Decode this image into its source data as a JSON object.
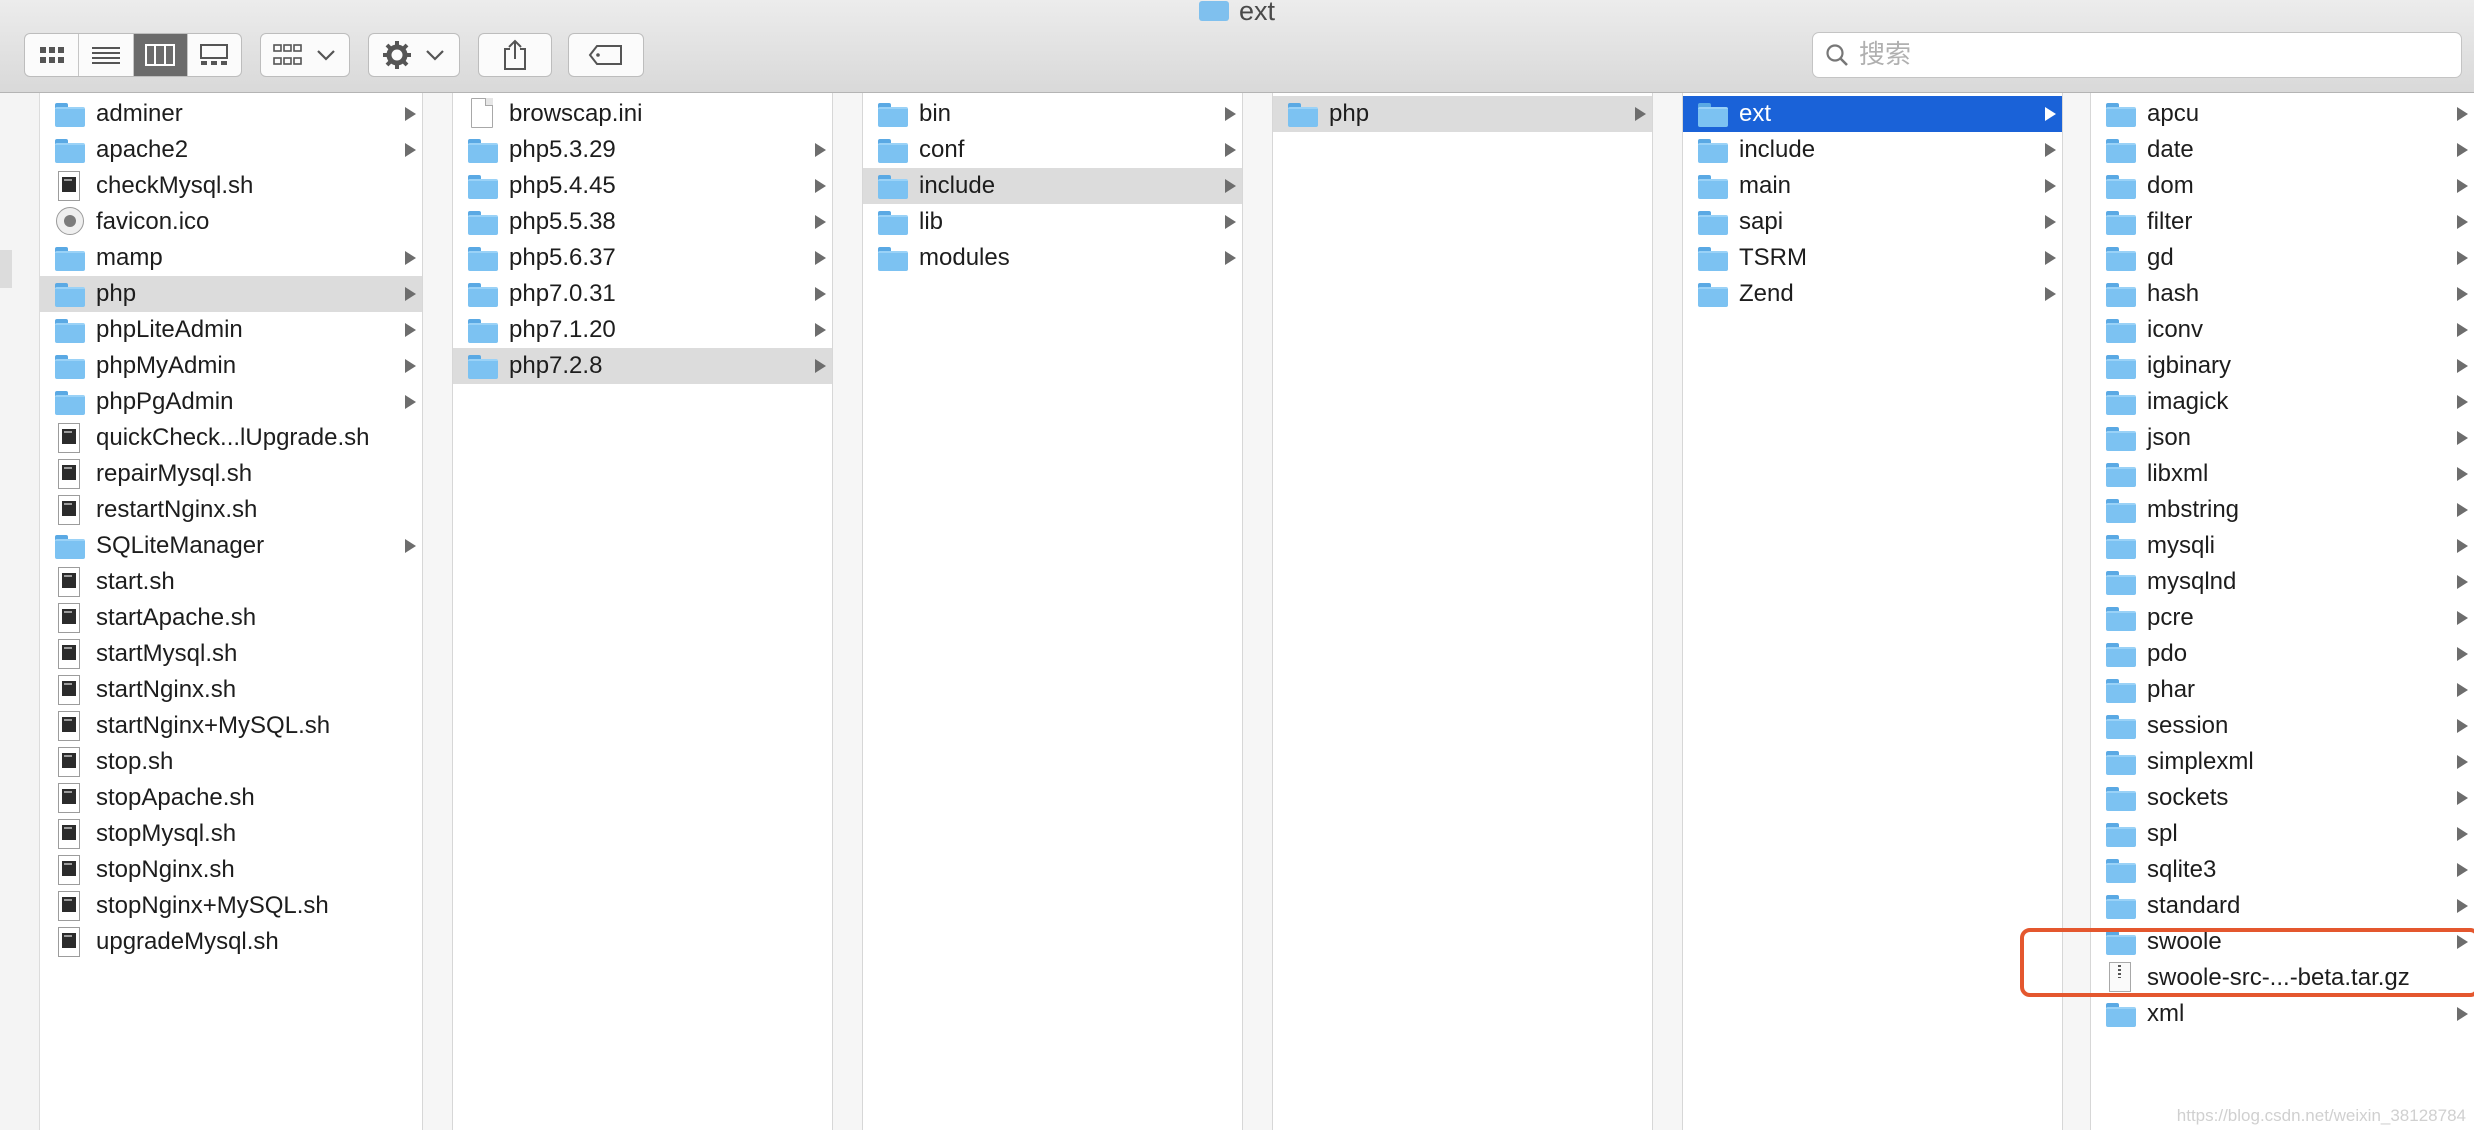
{
  "window": {
    "title": "ext"
  },
  "search": {
    "placeholder": "搜索",
    "value": ""
  },
  "toolbar": {
    "view_modes": [
      "icon",
      "list",
      "column",
      "gallery"
    ],
    "active_view": "column"
  },
  "columns": [
    {
      "items": [
        {
          "label": "adminer",
          "kind": "folder",
          "arrow": true
        },
        {
          "label": "apache2",
          "kind": "folder",
          "arrow": true
        },
        {
          "label": "checkMysql.sh",
          "kind": "script",
          "arrow": false
        },
        {
          "label": "favicon.ico",
          "kind": "icon-file",
          "arrow": false
        },
        {
          "label": "mamp",
          "kind": "folder",
          "arrow": true
        },
        {
          "label": "php",
          "kind": "folder",
          "arrow": true,
          "selected": true
        },
        {
          "label": "phpLiteAdmin",
          "kind": "folder",
          "arrow": true
        },
        {
          "label": "phpMyAdmin",
          "kind": "folder",
          "arrow": true
        },
        {
          "label": "phpPgAdmin",
          "kind": "folder",
          "arrow": true
        },
        {
          "label": "quickCheck...lUpgrade.sh",
          "kind": "script",
          "arrow": false
        },
        {
          "label": "repairMysql.sh",
          "kind": "script",
          "arrow": false
        },
        {
          "label": "restartNginx.sh",
          "kind": "script",
          "arrow": false
        },
        {
          "label": "SQLiteManager",
          "kind": "folder",
          "arrow": true
        },
        {
          "label": "start.sh",
          "kind": "script",
          "arrow": false
        },
        {
          "label": "startApache.sh",
          "kind": "script",
          "arrow": false
        },
        {
          "label": "startMysql.sh",
          "kind": "script",
          "arrow": false
        },
        {
          "label": "startNginx.sh",
          "kind": "script",
          "arrow": false
        },
        {
          "label": "startNginx+MySQL.sh",
          "kind": "script",
          "arrow": false
        },
        {
          "label": "stop.sh",
          "kind": "script",
          "arrow": false
        },
        {
          "label": "stopApache.sh",
          "kind": "script",
          "arrow": false
        },
        {
          "label": "stopMysql.sh",
          "kind": "script",
          "arrow": false
        },
        {
          "label": "stopNginx.sh",
          "kind": "script",
          "arrow": false
        },
        {
          "label": "stopNginx+MySQL.sh",
          "kind": "script",
          "arrow": false
        },
        {
          "label": "upgradeMysql.sh",
          "kind": "script",
          "arrow": false
        }
      ]
    },
    {
      "items": [
        {
          "label": "browscap.ini",
          "kind": "doc",
          "arrow": false
        },
        {
          "label": "php5.3.29",
          "kind": "folder",
          "arrow": true
        },
        {
          "label": "php5.4.45",
          "kind": "folder",
          "arrow": true
        },
        {
          "label": "php5.5.38",
          "kind": "folder",
          "arrow": true
        },
        {
          "label": "php5.6.37",
          "kind": "folder",
          "arrow": true
        },
        {
          "label": "php7.0.31",
          "kind": "folder",
          "arrow": true
        },
        {
          "label": "php7.1.20",
          "kind": "folder",
          "arrow": true
        },
        {
          "label": "php7.2.8",
          "kind": "folder",
          "arrow": true,
          "selected": true
        }
      ]
    },
    {
      "items": [
        {
          "label": "bin",
          "kind": "folder",
          "arrow": true
        },
        {
          "label": "conf",
          "kind": "folder",
          "arrow": true
        },
        {
          "label": "include",
          "kind": "folder",
          "arrow": true,
          "selected": true
        },
        {
          "label": "lib",
          "kind": "folder",
          "arrow": true
        },
        {
          "label": "modules",
          "kind": "folder",
          "arrow": true
        }
      ]
    },
    {
      "items": [
        {
          "label": "php",
          "kind": "folder",
          "arrow": true,
          "selected": true
        }
      ]
    },
    {
      "items": [
        {
          "label": "ext",
          "kind": "folder",
          "arrow": true,
          "selected": true,
          "active": true
        },
        {
          "label": "include",
          "kind": "folder",
          "arrow": true
        },
        {
          "label": "main",
          "kind": "folder",
          "arrow": true
        },
        {
          "label": "sapi",
          "kind": "folder",
          "arrow": true
        },
        {
          "label": "TSRM",
          "kind": "folder",
          "arrow": true
        },
        {
          "label": "Zend",
          "kind": "folder",
          "arrow": true
        }
      ]
    },
    {
      "items": [
        {
          "label": "apcu",
          "kind": "folder",
          "arrow": true
        },
        {
          "label": "date",
          "kind": "folder",
          "arrow": true
        },
        {
          "label": "dom",
          "kind": "folder",
          "arrow": true
        },
        {
          "label": "filter",
          "kind": "folder",
          "arrow": true
        },
        {
          "label": "gd",
          "kind": "folder",
          "arrow": true
        },
        {
          "label": "hash",
          "kind": "folder",
          "arrow": true
        },
        {
          "label": "iconv",
          "kind": "folder",
          "arrow": true
        },
        {
          "label": "igbinary",
          "kind": "folder",
          "arrow": true
        },
        {
          "label": "imagick",
          "kind": "folder",
          "arrow": true
        },
        {
          "label": "json",
          "kind": "folder",
          "arrow": true
        },
        {
          "label": "libxml",
          "kind": "folder",
          "arrow": true
        },
        {
          "label": "mbstring",
          "kind": "folder",
          "arrow": true
        },
        {
          "label": "mysqli",
          "kind": "folder",
          "arrow": true
        },
        {
          "label": "mysqlnd",
          "kind": "folder",
          "arrow": true
        },
        {
          "label": "pcre",
          "kind": "folder",
          "arrow": true
        },
        {
          "label": "pdo",
          "kind": "folder",
          "arrow": true
        },
        {
          "label": "phar",
          "kind": "folder",
          "arrow": true
        },
        {
          "label": "session",
          "kind": "folder",
          "arrow": true
        },
        {
          "label": "simplexml",
          "kind": "folder",
          "arrow": true
        },
        {
          "label": "sockets",
          "kind": "folder",
          "arrow": true
        },
        {
          "label": "spl",
          "kind": "folder",
          "arrow": true
        },
        {
          "label": "sqlite3",
          "kind": "folder",
          "arrow": true
        },
        {
          "label": "standard",
          "kind": "folder",
          "arrow": true
        },
        {
          "label": "swoole",
          "kind": "folder",
          "arrow": true
        },
        {
          "label": "swoole-src-...-beta.tar.gz",
          "kind": "archive",
          "arrow": false
        },
        {
          "label": "xml",
          "kind": "folder",
          "arrow": true
        }
      ]
    }
  ],
  "watermark": "https://blog.csdn.net/weixin_38128784",
  "colors": {
    "accent": "#1a62d8",
    "highlight": "#e4572e",
    "folder": "#7cc2f2"
  }
}
